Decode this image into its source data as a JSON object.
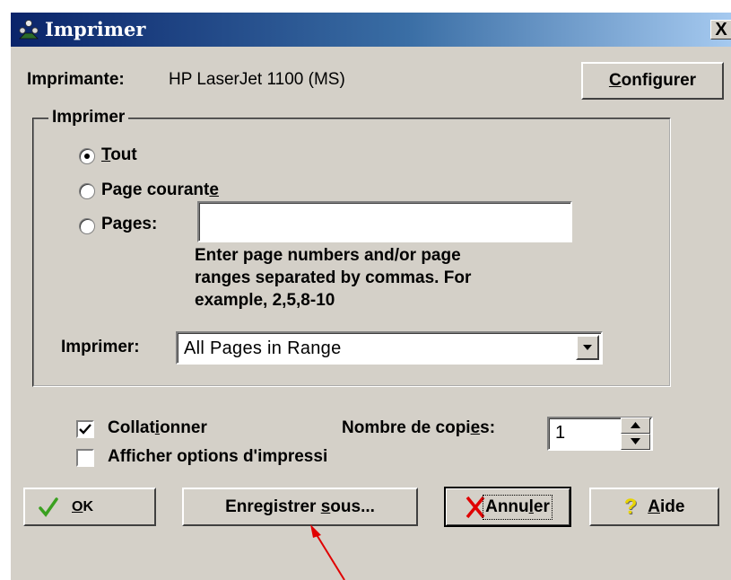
{
  "dialog": {
    "title": "Imprimer",
    "close_label": "X"
  },
  "printer": {
    "label": "Imprimante:",
    "name": "HP LaserJet 1100 (MS)",
    "configure_label": "Configurer"
  },
  "print_range": {
    "group_label": "Imprimer",
    "options": [
      {
        "label": "Tout",
        "mnemonic_index": 0,
        "selected": true
      },
      {
        "label": "Page courante",
        "selected": false
      },
      {
        "label": "Pages:",
        "selected": false
      }
    ],
    "pages_input_value": "",
    "help_text_lines": [
      "Enter page numbers and/or page",
      "ranges separated by commas. For",
      "example, 2,5,8-10"
    ],
    "print_label": "Imprimer:",
    "print_select_value": "All Pages in Range"
  },
  "options": {
    "collate_label": "Collationner",
    "collate_checked": true,
    "show_options_label": "Afficher options d'impressi",
    "show_options_checked": false,
    "copies_label": "Nombre de copies:",
    "copies_value": "1"
  },
  "buttons": {
    "ok": "OK",
    "save_as": "Enregistrer sous...",
    "cancel": "Annuler",
    "help": "Aide"
  },
  "colors": {
    "titlebar_start": "#0a246a",
    "titlebar_end": "#a6caf0",
    "annotation_arrow": "#e00000",
    "ok_check": "#3aa020",
    "cancel_x": "#e00000",
    "help_question": "#e8d400"
  },
  "icons": {
    "title": "printer-people-icon",
    "ok": "check-icon",
    "cancel": "x-icon",
    "help": "question-mark-icon"
  }
}
